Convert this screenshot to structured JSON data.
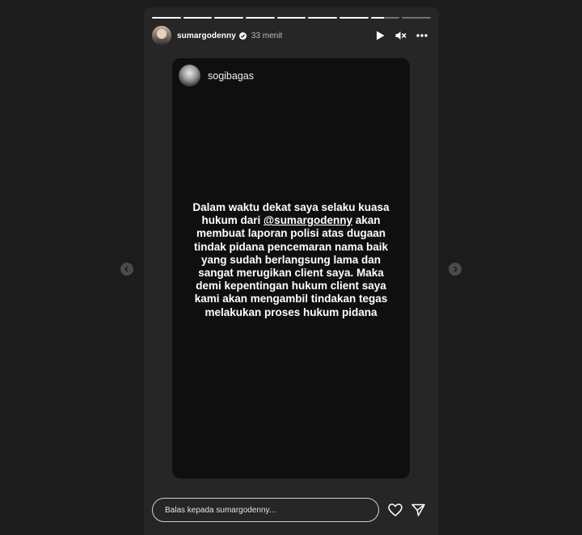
{
  "header": {
    "username": "sumargodenny",
    "time": "33 menit",
    "icons": {
      "play": "play-icon",
      "mute": "speaker-muted-icon",
      "more": "more-options-icon",
      "verified": "verified-badge-icon"
    }
  },
  "progress": {
    "segments": 9,
    "current_index": 7,
    "current_fraction": 0.45
  },
  "card": {
    "username": "sogibagas",
    "message_before": "Dalam waktu dekat saya selaku kuasa hukum dari ",
    "mention": "@sumargodenny",
    "message_after": " akan membuat laporan polisi atas dugaan tindak pidana pencemaran nama baik yang sudah berlangsung lama dan sangat merugikan client saya. Maka demi kepentingan hukum client saya kami akan mengambil tindakan tegas melakukan proses hukum pidana"
  },
  "reply": {
    "placeholder": "Balas kepada sumargodenny...",
    "icons": {
      "like": "heart-icon",
      "share": "send-icon"
    }
  },
  "nav": {
    "prev": "chevron-left-icon",
    "next": "chevron-right-icon"
  },
  "colors": {
    "page_bg": "#1c1c1c",
    "story_bg": "#262626",
    "card_bg": "#0f0f0f"
  }
}
